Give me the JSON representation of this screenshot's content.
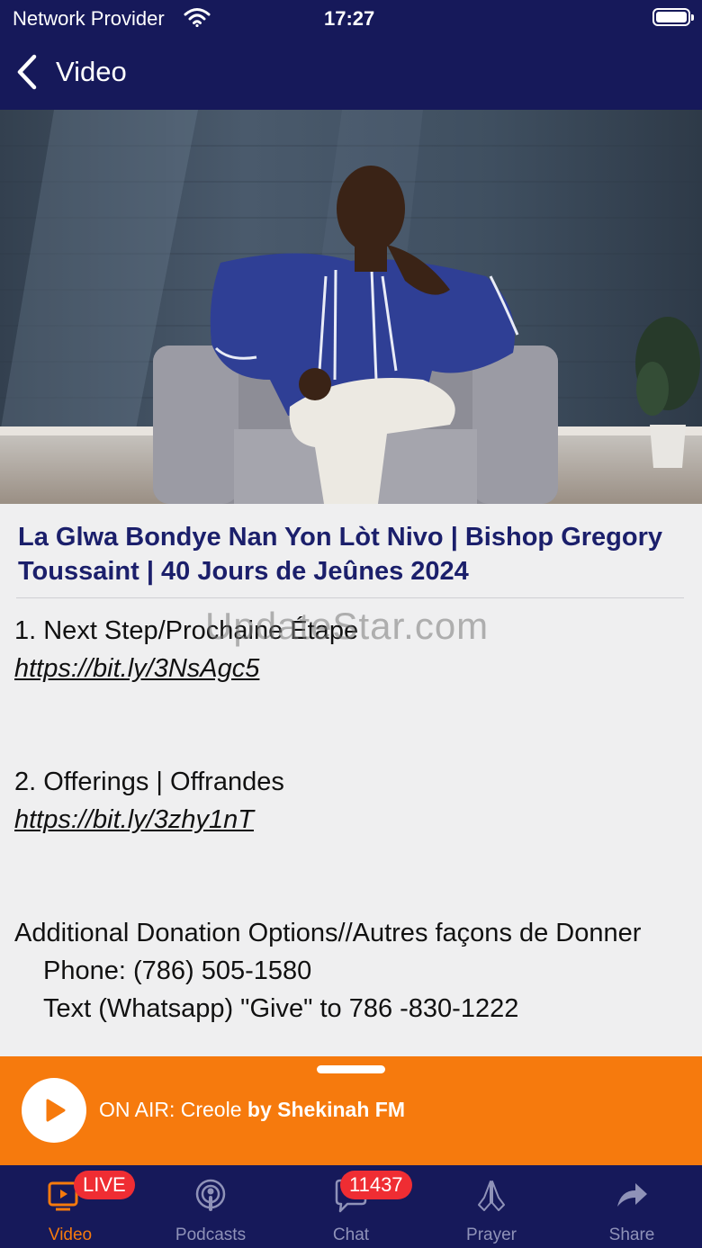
{
  "status_bar": {
    "provider": "Network Provider",
    "time": "17:27"
  },
  "nav": {
    "title": "Video"
  },
  "video": {
    "title": "La Glwa Bondye Nan Yon Lòt Nivo | Bishop Gregory Toussaint | 40 Jours de Jeûnes 2024",
    "description": {
      "item1": "1. Next Step/Prochaine Étape",
      "link1": "https://bit.ly/3NsAgc5",
      "item2": "2. Offerings | Offrandes",
      "link2": "https://bit.ly/3zhy1nT",
      "donation_heading": "Additional Donation Options//Autres façons de Donner",
      "phone": "Phone: (786) 505-1580",
      "text": "Text (Whatsapp)  \"Give\" to 786 -830-1222"
    }
  },
  "watermark": "UpdateStar.com",
  "player": {
    "prefix": "ON AIR: Creole",
    "suffix": "by Shekinah FM"
  },
  "tabs": [
    {
      "label": "Video",
      "icon": "tv-icon",
      "badge": "LIVE",
      "active": true
    },
    {
      "label": "Podcasts",
      "icon": "podcast-icon"
    },
    {
      "label": "Chat",
      "icon": "chat-icon",
      "badge": "11437"
    },
    {
      "label": "Prayer",
      "icon": "praying-hands-icon"
    },
    {
      "label": "Share",
      "icon": "share-arrow-icon"
    }
  ],
  "colors": {
    "nav_bg": "#16195a",
    "accent": "#f67a0d",
    "title": "#1b1f6b",
    "badge": "#ef2d33"
  }
}
